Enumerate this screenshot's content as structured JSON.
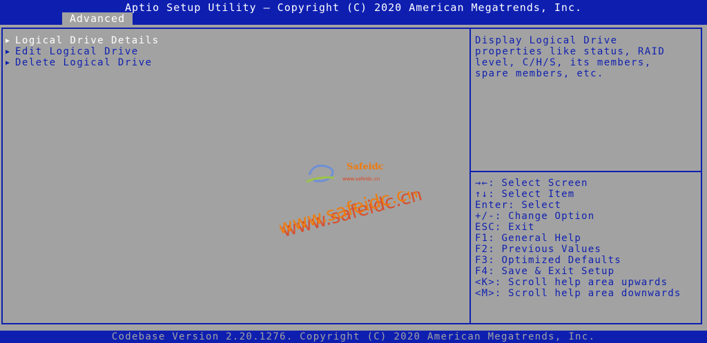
{
  "header": {
    "title": "Aptio Setup Utility – Copyright (C) 2020 American Megatrends, Inc.",
    "active_tab": "Advanced"
  },
  "menu": {
    "items": [
      {
        "label": "Logical Drive Details",
        "selected": true
      },
      {
        "label": "Edit Logical Drive",
        "selected": false
      },
      {
        "label": "Delete Logical Drive",
        "selected": false
      }
    ]
  },
  "help": {
    "lines": [
      "Display Logical Drive",
      "properties like status, RAID",
      "level, C/H/S, its members,",
      "spare members, etc."
    ]
  },
  "keys": {
    "lines": [
      "→←: Select Screen",
      "↑↓: Select Item",
      "Enter: Select",
      "+/-: Change Option",
      "ESC: Exit",
      "F1: General Help",
      "F2: Previous Values",
      "F3: Optimized Defaults",
      "F4: Save & Exit Setup",
      "<K>: Scroll help area upwards",
      "<M>: Scroll help area downwards"
    ]
  },
  "footer": {
    "text": "Codebase Version 2.20.1276. Copyright (C) 2020 American Megatrends, Inc."
  },
  "watermark": {
    "logo_text": "Safeidc",
    "logo_subtext": "www.safeidc.cn",
    "main_text": "www.safeidc.cn"
  },
  "colors": {
    "bios_blue": "#0e1fb0",
    "bios_gray": "#a2a2a2",
    "selected_text": "#ffffff",
    "watermark_orange": "#f07a0c",
    "watermark_red": "#e0421a"
  }
}
